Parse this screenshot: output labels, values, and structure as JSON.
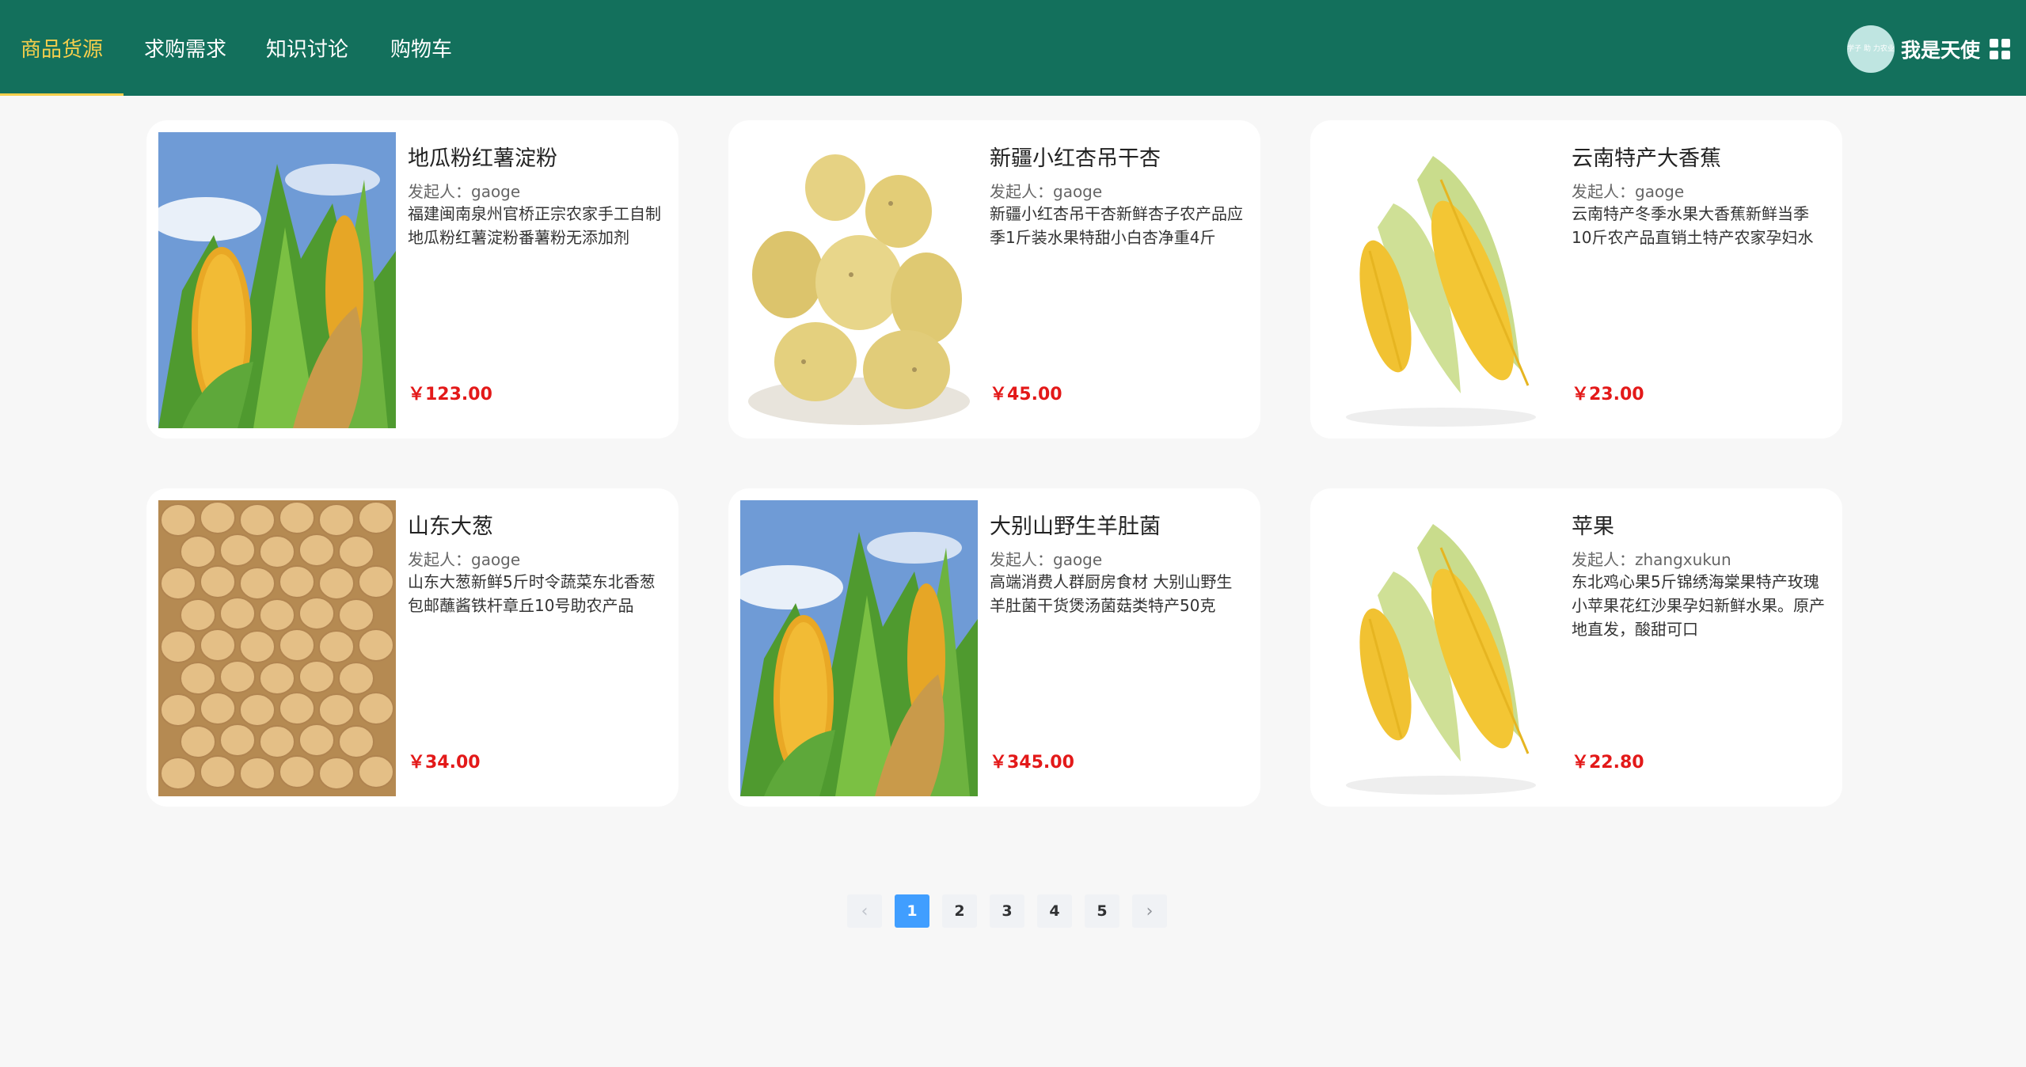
{
  "nav": {
    "items": [
      {
        "label": "商品货源",
        "active": true
      },
      {
        "label": "求购需求",
        "active": false
      },
      {
        "label": "知识讨论",
        "active": false
      },
      {
        "label": "购物车",
        "active": false
      }
    ]
  },
  "user": {
    "avatar_text": "学子 助\n力农业",
    "name": "我是天使",
    "menu_icon": "grid-menu-icon"
  },
  "products": [
    {
      "title": "地瓜粉红薯淀粉",
      "author": "发起人：gaoge",
      "desc": "福建闽南泉州官桥正宗农家手工自制地瓜粉红薯淀粉番薯粉无添加剂",
      "price": "￥123.00",
      "image": "corn-on-stalk"
    },
    {
      "title": "新疆小红杏吊干杏",
      "author": "发起人：gaoge",
      "desc": "新疆小红杏吊干杏新鲜杏子农产品应季1斤装水果特甜小白杏净重4斤",
      "price": "￥45.00",
      "image": "potatoes"
    },
    {
      "title": "云南特产大香蕉",
      "author": "发起人：gaoge",
      "desc": "云南特产冬季水果大香蕉新鲜当季10斤农产品直销土特产农家孕妇水",
      "price": "￥23.00",
      "image": "corn-cobs"
    },
    {
      "title": "山东大葱",
      "author": "发起人：gaoge",
      "desc": "山东大葱新鲜5斤时令蔬菜东北香葱包邮蘸酱铁杆章丘10号助农产品",
      "price": "￥34.00",
      "image": "soybeans"
    },
    {
      "title": "大别山野生羊肚菌",
      "author": "发起人：gaoge",
      "desc": "高端消费人群厨房食材 大别山野生羊肚菌干货煲汤菌菇类特产50克",
      "price": "￥345.00",
      "image": "corn-on-stalk"
    },
    {
      "title": "苹果",
      "author": "发起人：zhangxukun",
      "desc": "东北鸡心果5斤锦绣海棠果特产玫瑰小苹果花红沙果孕妇新鲜水果。原产地直发，酸甜可口",
      "price": "￥22.80",
      "image": "corn-cobs"
    }
  ],
  "pagination": {
    "prev": "‹",
    "pages": [
      "1",
      "2",
      "3",
      "4",
      "5"
    ],
    "current": "1",
    "next": "›"
  },
  "colors": {
    "header_bg": "#13705c",
    "active_nav": "#f6cf4c",
    "price": "#e31919",
    "page_active": "#409eff"
  }
}
